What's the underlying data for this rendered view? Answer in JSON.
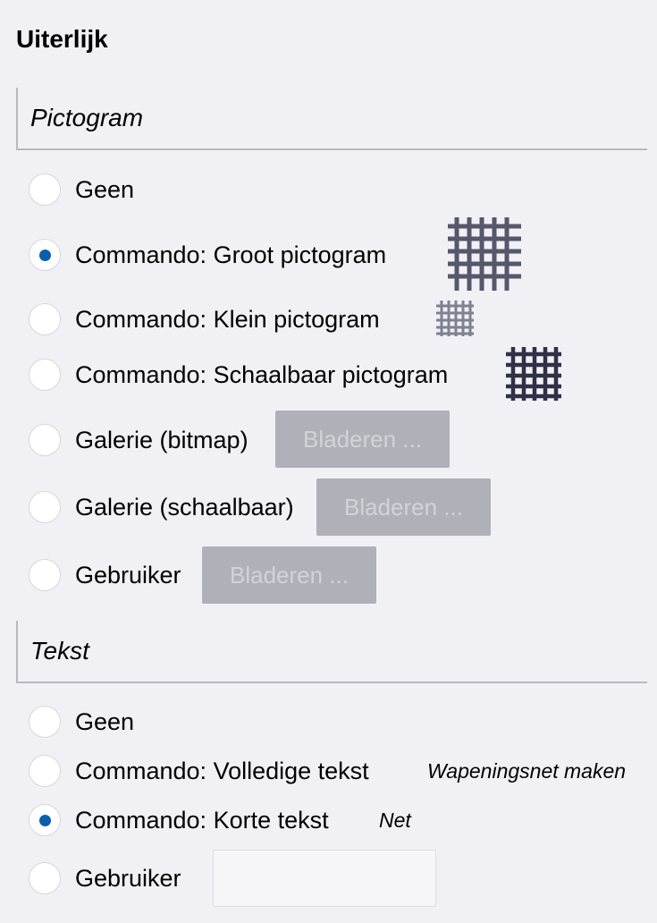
{
  "title": "Uiterlijk",
  "pictogram": {
    "heading": "Pictogram",
    "options": [
      {
        "label": "Geen",
        "checked": false
      },
      {
        "label": "Commando: Groot pictogram",
        "checked": true
      },
      {
        "label": "Commando: Klein pictogram",
        "checked": false
      },
      {
        "label": "Commando: Schaalbaar pictogram",
        "checked": false
      },
      {
        "label": "Galerie (bitmap)",
        "checked": false,
        "button": "Bladeren ..."
      },
      {
        "label": "Galerie (schaalbaar)",
        "checked": false,
        "button": "Bladeren ..."
      },
      {
        "label": "Gebruiker",
        "checked": false,
        "button": "Bladeren ..."
      }
    ],
    "icon_names": [
      "mesh-large-icon",
      "mesh-small-icon",
      "mesh-scalable-icon"
    ]
  },
  "tekst": {
    "heading": "Tekst",
    "options": [
      {
        "label": "Geen",
        "checked": false
      },
      {
        "label": "Commando: Volledige tekst",
        "checked": false,
        "hint": "Wapeningsnet maken"
      },
      {
        "label": "Commando: Korte tekst",
        "checked": true,
        "hint": "Net"
      },
      {
        "label": "Gebruiker",
        "checked": false,
        "value": ""
      }
    ]
  },
  "colors": {
    "background": "#f1f0f5",
    "radio_selected": "#0a5fa8",
    "button_disabled_bg": "#b0b0b8",
    "button_disabled_text": "#d2d2d7"
  }
}
